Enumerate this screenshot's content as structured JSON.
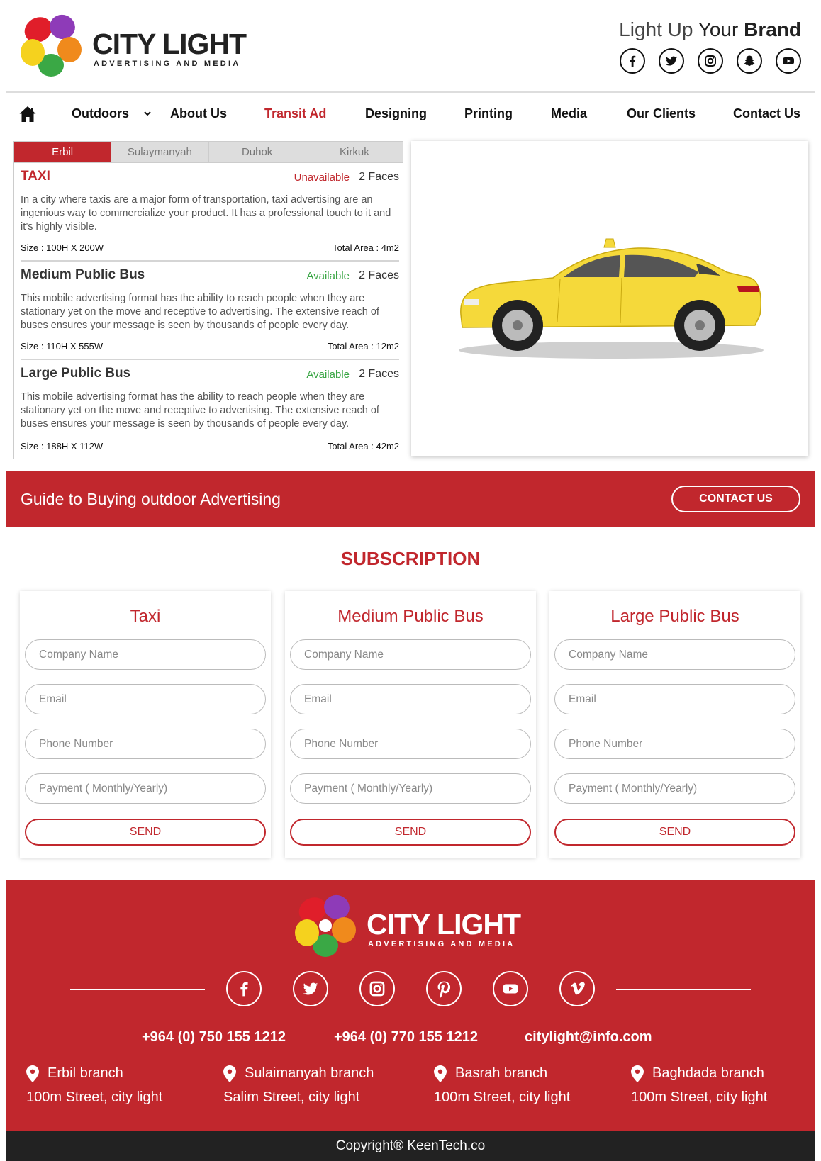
{
  "brand": {
    "name": "CITY LIGHT",
    "sub": "ADVERTISING AND MEDIA",
    "tagline_light": "Light Up",
    "tagline_mid": "Your",
    "tagline_bold": "Brand"
  },
  "top_socials": [
    "facebook-icon",
    "twitter-icon",
    "instagram-icon",
    "snapchat-icon",
    "youtube-icon"
  ],
  "nav": {
    "outdoors": "Outdoors",
    "about": "About Us",
    "transit": "Transit Ad",
    "designing": "Designing",
    "printing": "Printing",
    "media": "Media",
    "clients": "Our Clients",
    "contact": "Contact Us"
  },
  "tabs": [
    "Erbil",
    "Sulaymanyah",
    "Duhok",
    "Kirkuk"
  ],
  "ads": [
    {
      "title": "TAXI",
      "status": "Unavailable",
      "faces": "2 Faces",
      "desc": "In a city where taxis are a major form of transportation, taxi advertising are an ingenious way to commercialize your product. It has a professional touch to it and it’s highly visible.",
      "size": "Size : 100H X 200W",
      "area": "Total Area : 4m2"
    },
    {
      "title": "Medium Public Bus",
      "status": "Available",
      "faces": "2 Faces",
      "desc": "This mobile advertising format has the ability to reach people when they are stationary yet on the move and receptive to advertising. The extensive reach of buses ensures your message is seen by thousands of people every day.",
      "size": "Size : 110H X 555W",
      "area": "Total Area : 12m2"
    },
    {
      "title": "Large Public Bus",
      "status": "Available",
      "faces": "2 Faces",
      "desc": "This mobile advertising format has the ability to reach people when they are stationary yet on the move and receptive to advertising. The extensive reach of buses ensures your message is seen by thousands of people every day.",
      "size": "Size : 188H X 112W",
      "area": "Total Area : 42m2"
    }
  ],
  "banner": {
    "text": "Guide to Buying outdoor Advertising",
    "button": "CONTACT US"
  },
  "subscription": {
    "title": "SUBSCRIPTION",
    "cards": [
      {
        "title": "Taxi"
      },
      {
        "title": "Medium Public Bus"
      },
      {
        "title": "Large Public Bus"
      }
    ],
    "placeholders": {
      "company": "Company Name",
      "email": "Email",
      "phone": "Phone Number",
      "payment": "Payment ( Monthly/Yearly)"
    },
    "send": "SEND"
  },
  "footer": {
    "socials": [
      "facebook-icon",
      "twitter-icon",
      "instagram-icon",
      "pinterest-icon",
      "youtube-icon",
      "vimeo-icon"
    ],
    "phone1": "+964 (0) 750 155 1212",
    "phone2": "+964 (0) 770 155 1212",
    "email": "citylight@info.com",
    "branches": [
      {
        "name": "Erbil branch",
        "addr": "100m Street, city light"
      },
      {
        "name": "Sulaimanyah branch",
        "addr": "Salim Street, city light"
      },
      {
        "name": "Basrah branch",
        "addr": "100m Street, city light"
      },
      {
        "name": "Baghdada branch",
        "addr": "100m Street, city light"
      }
    ],
    "copyright": "Copyright® KeenTech.co"
  },
  "colors": {
    "accent": "#c1272d",
    "available": "#3aa645",
    "taxi_yellow": "#f5d93a",
    "copyright_bar": "#222222"
  }
}
